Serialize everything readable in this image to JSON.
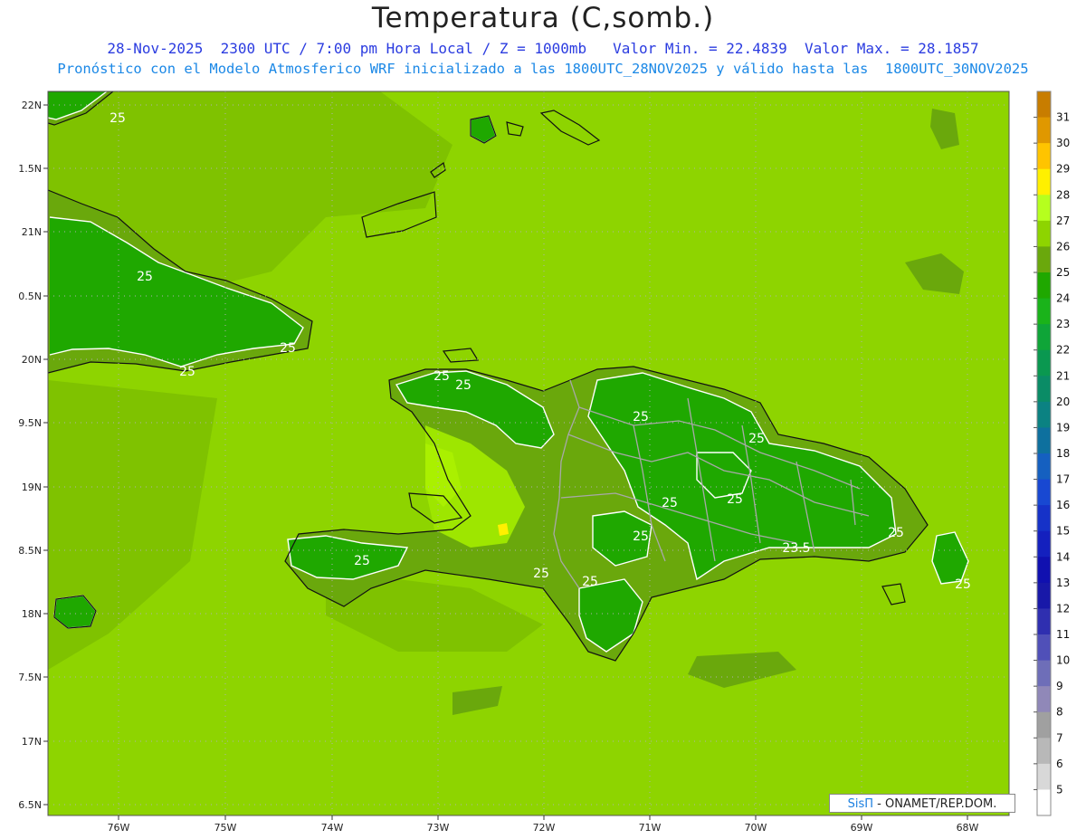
{
  "header": {
    "title": "Temperatura (C,somb.)",
    "subtitle_line1": "28-Nov-2025  2300 UTC / 7:00 pm Hora Local / Z = 1000mb   Valor Min. = 22.4839  Valor Max. = 28.1857",
    "subtitle_line2": "Pronóstico con el Modelo Atmosferico WRF inicializado a las 1800UTC_28NOV2025 y válido hasta las  1800UTC_30NOV2025"
  },
  "map": {
    "lon_labels": [
      "76W",
      "75W",
      "74W",
      "73W",
      "72W",
      "71W",
      "70W",
      "69W",
      "68W"
    ],
    "lat_labels": [
      "22N",
      "1.5N",
      "21N",
      "0.5N",
      "20N",
      "9.5N",
      "19N",
      "8.5N",
      "18N",
      "7.5N",
      "17N",
      "6.5N"
    ],
    "contour_labels": [
      "25",
      "25",
      "25",
      "25",
      "25",
      "25",
      "25",
      "25",
      "25",
      "25",
      "25",
      "25",
      "25",
      "23.5",
      "25",
      "25",
      "25"
    ],
    "background_color": "#8ed400",
    "land_color_low": "#1fa800",
    "land_color_mid": "#6aa80c",
    "warm_color": "#aaf000"
  },
  "colorbar": {
    "labels": [
      "31",
      "30",
      "29",
      "28",
      "27",
      "26",
      "25",
      "24",
      "23",
      "22",
      "21",
      "20",
      "19",
      "18",
      "17",
      "16",
      "15",
      "14",
      "13",
      "12",
      "11",
      "10",
      "9",
      "8",
      "7",
      "6",
      "5"
    ],
    "colors": [
      "#c87d00",
      "#e09800",
      "#ffc400",
      "#fff000",
      "#b6ff1e",
      "#8ed400",
      "#6aa80c",
      "#1fa800",
      "#1ab31a",
      "#0fa538",
      "#0a9850",
      "#0a8c66",
      "#0b8282",
      "#0e709e",
      "#1560c0",
      "#1848d2",
      "#1632c8",
      "#1420be",
      "#1010b0",
      "#1818a8",
      "#2f2fb0",
      "#5050b8",
      "#6e6eb8",
      "#9088b8",
      "#a0a0a0",
      "#b8b8b8",
      "#d8d8d8",
      "#ffffff"
    ]
  },
  "credit": {
    "brand": "SisΠ",
    "text": " - ONAMET/REP.DOM."
  }
}
